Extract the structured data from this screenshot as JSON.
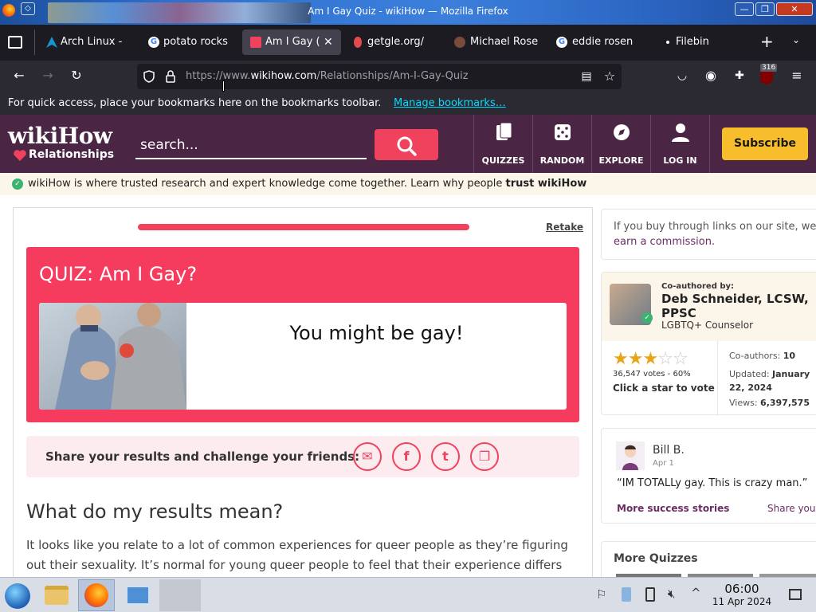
{
  "window": {
    "title": "Am I Gay Quiz - wikiHow — Mozilla Firefox",
    "min": "—",
    "max": "❐",
    "close": "✕"
  },
  "tabs": [
    {
      "label": "Arch Linux -"
    },
    {
      "label": "potato rocks"
    },
    {
      "label": "Am I Gay ("
    },
    {
      "label": "getgle.org/"
    },
    {
      "label": "Michael Rose"
    },
    {
      "label": "eddie rosen"
    },
    {
      "label": "Filebin"
    }
  ],
  "nav": {
    "url_prefix": "https://www.",
    "url_domain": "wikihow.com",
    "url_path": "/Relationships/Am-I-Gay-Quiz",
    "ublock_count": "316"
  },
  "bookmarks_bar": {
    "message": "For quick access, place your bookmarks here on the bookmarks toolbar.",
    "link": "Manage bookmarks…"
  },
  "header": {
    "logo": "wikiHow",
    "section": "Relationships",
    "search_placeholder": "search...",
    "nav": [
      {
        "label": "QUIZZES",
        "icon": "quizzes-icon"
      },
      {
        "label": "RANDOM",
        "icon": "dice-icon"
      },
      {
        "label": "EXPLORE",
        "icon": "compass-icon"
      },
      {
        "label": "LOG IN",
        "icon": "user-icon"
      }
    ],
    "subscribe": "Subscribe"
  },
  "trust": {
    "text": "wikiHow is where trusted research and expert knowledge come together. Learn why people ",
    "bold": "trust wikiHow"
  },
  "quiz": {
    "retake": "Retake",
    "title": "QUIZ: Am I Gay?",
    "result": "You might be gay!",
    "share_text": "Share your results and challenge your friends:",
    "progress": 1.0
  },
  "results": {
    "heading": "What do my results mean?",
    "body": "It looks like you relate to a lot of common experiences for queer people as they’re figuring out their sexuality. It’s normal for young queer people to feel that their experience differs from the"
  },
  "sidebar": {
    "affiliate_line1": "If you buy through links on our site, we m",
    "affiliate_link": "earn a commission.",
    "coauthor_label": "Co-authored by:",
    "author_name": "Deb Schneider, LCSW, PPSC",
    "author_title": "LGBTQ+ Counselor",
    "rating_stars": 3,
    "votes": "36,547 votes - 60%",
    "rate_prompt": "Click a star to vote",
    "coauthors_label": "Co-authors:",
    "coauthors_value": "10",
    "updated_label": "Updated:",
    "updated_value": "January 22, 2024",
    "views_label": "Views:",
    "views_value": "6,397,575",
    "review_name": "Bill B.",
    "review_date": "Apr 1",
    "review_text": "“IM TOTALLy gay. This is crazy man.”",
    "more_stories": "More success stories",
    "share_yours": "Share your",
    "more_quizzes": "More Quizzes"
  },
  "taskbar": {
    "time": "06:00",
    "date": "11 Apr 2024"
  },
  "colors": {
    "accent": "#f0425c",
    "header_bg": "#4a2644",
    "subscribe": "#f7bd2c",
    "link_purple": "#6b2c64"
  }
}
